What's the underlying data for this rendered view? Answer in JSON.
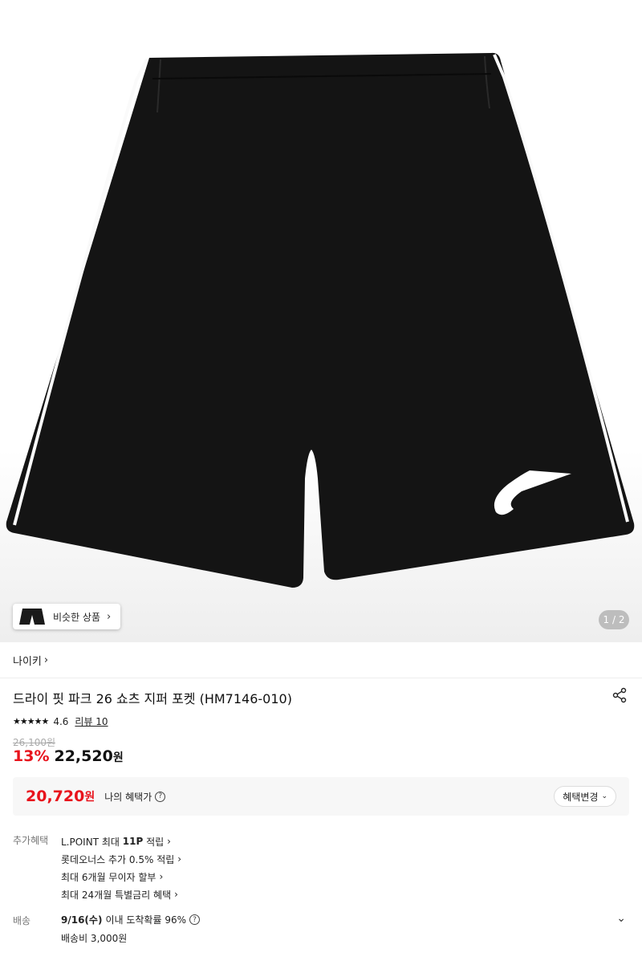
{
  "gallery": {
    "similar_label": "비슷한 상품",
    "pager": "1 / 2"
  },
  "product": {
    "brand": "나이키",
    "title": "드라이 핏 파크 26 쇼츠 지퍼 포켓 (HM7146-010)",
    "rating": "4.6",
    "stars": 4.6,
    "review_label": "리뷰 10",
    "original_price": "26,100원",
    "discount": "13%",
    "sale_price": "22,520",
    "currency": "원"
  },
  "benefit": {
    "price": "20,720",
    "currency": "원",
    "label": "나의 혜택가",
    "change_label": "혜택변경"
  },
  "extra_benefits": {
    "label": "추가혜택",
    "lpoint_prefix": "L.POINT 최대 ",
    "lpoint_bold": "11P",
    "lpoint_suffix": " 적립",
    "items": [
      "롯데오너스 추가 0.5% 적립",
      "최대 6개월 무이자 할부",
      "최대 24개월 특별금리 혜택"
    ]
  },
  "shipping": {
    "label": "배송",
    "date": "9/16(수)",
    "rate_text": "이내 도착확률 96%",
    "fee": "배송비 3,000원"
  },
  "colors": {
    "accent_red": "#e8131c",
    "bg_box": "#f7f7f7"
  }
}
